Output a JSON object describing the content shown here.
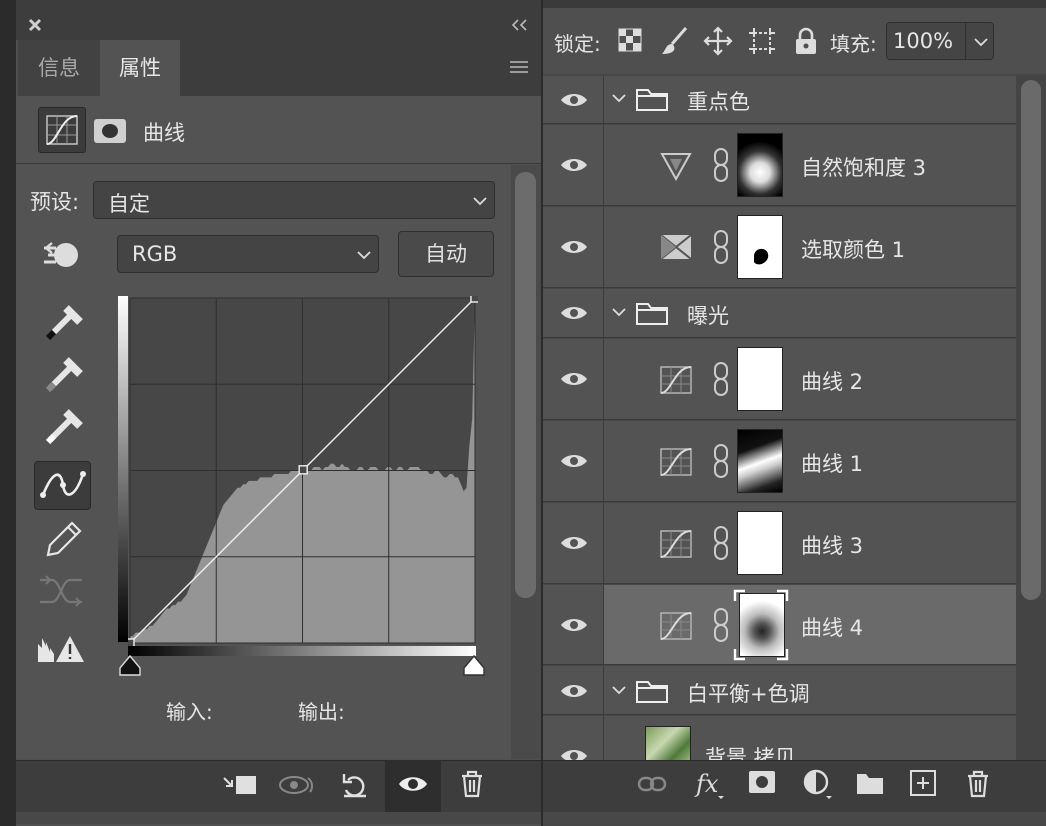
{
  "properties_panel": {
    "tabs": [
      {
        "label": "信息"
      },
      {
        "label": "属性"
      }
    ],
    "adjustment_label": "曲线",
    "preset_label": "预设:",
    "preset_value": "自定",
    "channel_value": "RGB",
    "auto_label": "自动",
    "input_label": "输入:",
    "output_label": "输出:"
  },
  "curve": {
    "points": [
      [
        0,
        0
      ],
      [
        128,
        128
      ],
      [
        255,
        255
      ]
    ],
    "histogram": [
      2,
      2,
      3,
      3,
      3,
      4,
      4,
      5,
      5,
      6,
      7,
      8,
      9,
      10,
      10,
      11,
      11,
      12,
      12,
      13,
      14,
      16,
      18,
      20,
      22,
      24,
      26,
      28,
      30,
      32,
      34,
      36,
      38,
      40,
      41,
      42,
      43,
      44,
      45,
      45,
      46,
      46,
      47,
      47,
      47,
      47,
      48,
      48,
      48,
      48,
      48,
      49,
      49,
      49,
      49,
      49,
      49,
      50,
      50,
      50,
      50,
      51,
      51,
      50,
      50,
      51,
      51,
      51,
      50,
      51,
      51,
      52,
      52,
      51,
      51,
      52,
      51,
      51,
      50,
      50,
      50,
      51,
      51,
      50,
      50,
      51,
      51,
      51,
      50,
      50,
      50,
      51,
      51,
      50,
      50,
      51,
      51,
      50,
      50,
      51,
      51,
      51,
      51,
      50,
      50,
      50,
      49,
      49,
      50,
      50,
      49,
      48,
      48,
      49,
      49,
      48,
      48,
      46,
      44,
      45,
      57,
      65,
      100
    ]
  },
  "layers_panel": {
    "lock_label": "锁定:",
    "fill_label": "填充:",
    "fill_value": "100%",
    "layers": [
      {
        "type": "group",
        "name": "重点色"
      },
      {
        "type": "vibrance",
        "name": "自然饱和度 3"
      },
      {
        "type": "selective",
        "name": "选取颜色 1"
      },
      {
        "type": "group",
        "name": "曝光"
      },
      {
        "type": "curves",
        "name": "曲线 2"
      },
      {
        "type": "curves",
        "name": "曲线 1"
      },
      {
        "type": "curves",
        "name": "曲线 3"
      },
      {
        "type": "curves",
        "name": "曲线 4",
        "selected": true
      },
      {
        "type": "group",
        "name": "白平衡+色调"
      },
      {
        "type": "image",
        "name": "背景 拷贝"
      }
    ]
  },
  "colors": {
    "panel": "#535353",
    "selected": "#6a6a6a",
    "dark": "#3d3d3d"
  }
}
